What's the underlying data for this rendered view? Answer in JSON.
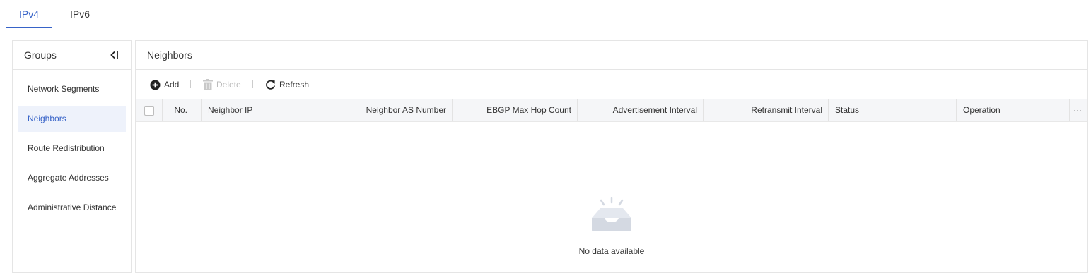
{
  "tabs": [
    {
      "label": "IPv4",
      "active": true
    },
    {
      "label": "IPv6",
      "active": false
    }
  ],
  "groups": {
    "title": "Groups",
    "items": [
      {
        "label": "Network Segments",
        "active": false
      },
      {
        "label": "Neighbors",
        "active": true
      },
      {
        "label": "Route Redistribution",
        "active": false
      },
      {
        "label": "Aggregate Addresses",
        "active": false
      },
      {
        "label": "Administrative Distance",
        "active": false
      }
    ]
  },
  "main": {
    "title": "Neighbors",
    "toolbar": {
      "add_label": "Add",
      "delete_label": "Delete",
      "refresh_label": "Refresh"
    },
    "columns": [
      "No.",
      "Neighbor IP",
      "Neighbor AS Number",
      "EBGP Max Hop Count",
      "Advertisement Interval",
      "Retransmit Interval",
      "Status",
      "Operation"
    ],
    "more_label": "···",
    "rows": [],
    "empty_text": "No data available"
  },
  "colors": {
    "accent": "#3763c8",
    "selected_bg": "#eef2fb",
    "header_bg": "#f5f6f8",
    "border": "#e5e5e5",
    "disabled": "#bbbbbb"
  },
  "icons": {
    "collapse": "collapse-left-icon",
    "add": "plus-circle-icon",
    "delete": "trash-icon",
    "refresh": "refresh-icon",
    "more": "more-horizontal-icon",
    "empty": "empty-inbox-icon"
  }
}
